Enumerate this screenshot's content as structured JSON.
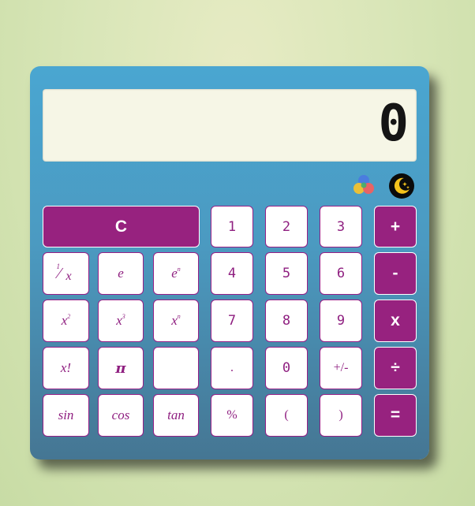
{
  "display": {
    "value": "0"
  },
  "theme": {
    "color_icon": "palette-colors-icon",
    "dark_icon": "moon-stars-icon",
    "accent": "#97227f",
    "background": "#4aa6d1"
  },
  "keys": {
    "clear": "C",
    "one": "1",
    "two": "2",
    "three": "3",
    "four": "4",
    "five": "5",
    "six": "6",
    "seven": "7",
    "eight": "8",
    "nine": "9",
    "zero": "0",
    "dot": ".",
    "plus": "+",
    "minus": "-",
    "multiply": "x",
    "divide": "÷",
    "equals": "=",
    "reciprocal_numerator": "1",
    "reciprocal_slash": "⁄",
    "reciprocal_denominator": "x",
    "e": "e",
    "e_base": "e",
    "e_exp": "n",
    "square_base": "x",
    "square_exp": "2",
    "cube_base": "x",
    "cube_exp": "3",
    "power_base": "x",
    "power_exp": "n",
    "factorial": "x!",
    "pi": "π",
    "blank": "",
    "sign": "+/-",
    "percent": "%",
    "open_paren": "(",
    "close_paren": ")",
    "sin": "sin",
    "cos": "cos",
    "tan": "tan"
  }
}
